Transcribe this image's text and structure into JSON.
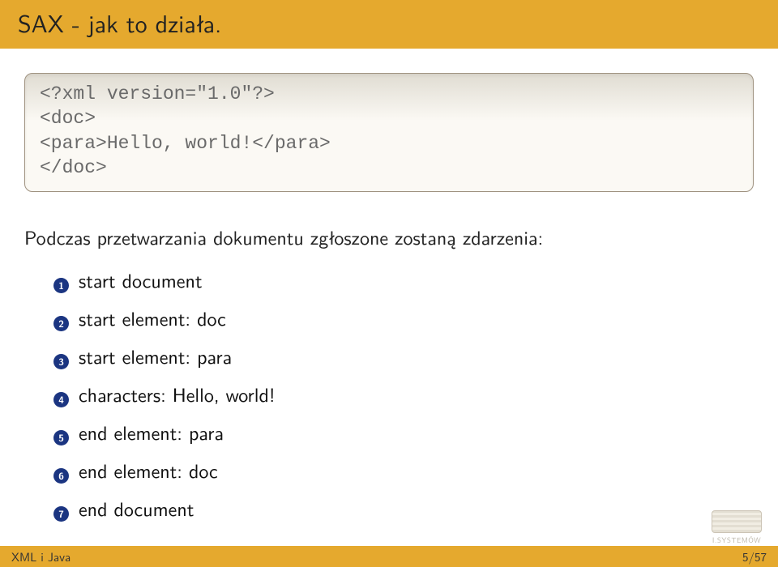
{
  "title": "SAX - jak to działa.",
  "code": {
    "line1": "<?xml version=\"1.0\"?>",
    "line2": "<doc>",
    "line3": "<para>Hello, world!</para>",
    "line4": "</doc>"
  },
  "intro": "Podczas przetwarzania dokumentu zgłoszone zostaną zdarzenia:",
  "items": [
    {
      "n": "1",
      "text": "start document"
    },
    {
      "n": "2",
      "text": "start element: doc"
    },
    {
      "n": "3",
      "text": "start element: para"
    },
    {
      "n": "4",
      "text": "characters: Hello, world!"
    },
    {
      "n": "5",
      "text": "end element: para"
    },
    {
      "n": "6",
      "text": "end element: doc"
    },
    {
      "n": "7",
      "text": "end document"
    }
  ],
  "footer": {
    "left": "XML i Java",
    "right": "5/57"
  },
  "logo_label": "I.SYSTEMÓW"
}
